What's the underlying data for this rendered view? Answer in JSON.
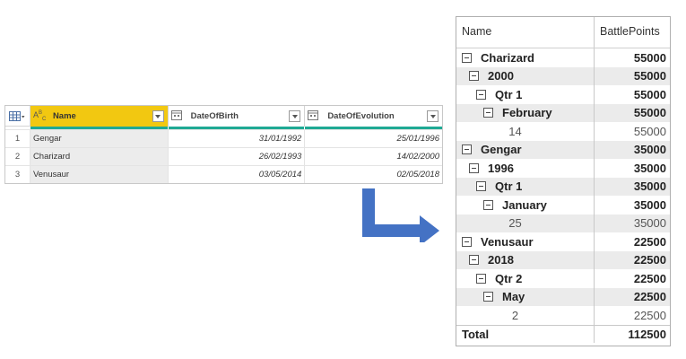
{
  "source_table": {
    "columns": [
      {
        "name": "Name",
        "type_icon": "abc-text-type-icon",
        "selected": true
      },
      {
        "name": "DateOfBirth",
        "type_icon": "calendar-type-icon",
        "selected": false
      },
      {
        "name": "DateOfEvolution",
        "type_icon": "calendar-type-icon",
        "selected": false
      }
    ],
    "rows": [
      {
        "num": "1",
        "name": "Gengar",
        "dob": "31/01/1992",
        "doe": "25/01/1996"
      },
      {
        "num": "2",
        "name": "Charizard",
        "dob": "26/02/1993",
        "doe": "14/02/2000"
      },
      {
        "num": "3",
        "name": "Venusaur",
        "dob": "03/05/2014",
        "doe": "02/05/2018"
      }
    ],
    "colors": {
      "selected_header": "#f2c811",
      "underline": "#1fa994"
    }
  },
  "arrow": {
    "color": "#4472c4",
    "icon": "right-angle-arrow-icon"
  },
  "matrix": {
    "headers": {
      "name": "Name",
      "value": "BattlePoints"
    },
    "rows": [
      {
        "label": "Charizard",
        "value": "55000",
        "level": 0,
        "bold": true,
        "shade": false,
        "expander": true
      },
      {
        "label": "2000",
        "value": "55000",
        "level": 1,
        "bold": true,
        "shade": true,
        "expander": true
      },
      {
        "label": "Qtr 1",
        "value": "55000",
        "level": 2,
        "bold": true,
        "shade": false,
        "expander": true
      },
      {
        "label": "February",
        "value": "55000",
        "level": 3,
        "bold": true,
        "shade": true,
        "expander": true
      },
      {
        "label": "14",
        "value": "55000",
        "level": 4,
        "bold": false,
        "shade": false,
        "expander": false
      },
      {
        "label": "Gengar",
        "value": "35000",
        "level": 0,
        "bold": true,
        "shade": true,
        "expander": true
      },
      {
        "label": "1996",
        "value": "35000",
        "level": 1,
        "bold": true,
        "shade": false,
        "expander": true
      },
      {
        "label": "Qtr 1",
        "value": "35000",
        "level": 2,
        "bold": true,
        "shade": true,
        "expander": true
      },
      {
        "label": "January",
        "value": "35000",
        "level": 3,
        "bold": true,
        "shade": false,
        "expander": true
      },
      {
        "label": "25",
        "value": "35000",
        "level": 4,
        "bold": false,
        "shade": true,
        "expander": false
      },
      {
        "label": "Venusaur",
        "value": "22500",
        "level": 0,
        "bold": true,
        "shade": false,
        "expander": true
      },
      {
        "label": "2018",
        "value": "22500",
        "level": 1,
        "bold": true,
        "shade": true,
        "expander": true
      },
      {
        "label": "Qtr 2",
        "value": "22500",
        "level": 2,
        "bold": true,
        "shade": false,
        "expander": true
      },
      {
        "label": "May",
        "value": "22500",
        "level": 3,
        "bold": true,
        "shade": true,
        "expander": true
      },
      {
        "label": "2",
        "value": "22500",
        "level": 4,
        "bold": false,
        "shade": false,
        "expander": false
      }
    ],
    "total": {
      "label": "Total",
      "value": "112500"
    }
  }
}
